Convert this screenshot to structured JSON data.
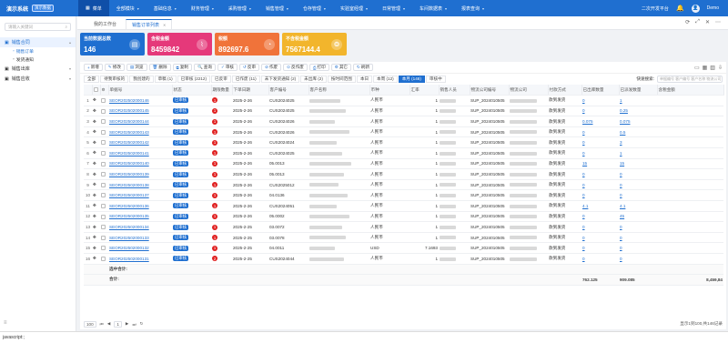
{
  "topbar": {
    "title": "演示系统",
    "env_tag": "演示数据",
    "nav": [
      {
        "label": "菜单",
        "icon": "grid-icon",
        "active": true
      },
      {
        "label": "全部模块",
        "active": false
      },
      {
        "label": "基础信息",
        "active": false
      },
      {
        "label": "财务管理",
        "active": false
      },
      {
        "label": "采购管理",
        "active": false
      },
      {
        "label": "销售管理",
        "active": false
      },
      {
        "label": "仓存管理",
        "active": false
      },
      {
        "label": "实验室经理",
        "active": false
      },
      {
        "label": "日常管理",
        "active": false
      },
      {
        "label": "车间数据表",
        "active": false
      },
      {
        "label": "报表查询",
        "active": false
      }
    ],
    "platform_label": "二次开发平台",
    "user_name": "Demo"
  },
  "sidebar": {
    "search_placeholder": "请输入关键词",
    "groups": [
      {
        "label": "销售合同",
        "open": true,
        "subs": [
          {
            "label": "销售订单",
            "active": true
          },
          {
            "label": "发货通知",
            "active": false
          }
        ]
      },
      {
        "label": "销售出库",
        "open": false,
        "subs": []
      },
      {
        "label": "销售应收",
        "open": false,
        "subs": []
      }
    ]
  },
  "page_tabs": [
    {
      "label": "我的工作台",
      "active": false
    },
    {
      "label": "销售订单列表",
      "active": true
    }
  ],
  "cards": [
    {
      "label": "当前数据总数",
      "value": "146",
      "color": "#1f6fd0",
      "icon": "document-icon"
    },
    {
      "label": "含税金额",
      "value": "8459842",
      "color": "#e5397a",
      "icon": "chart-icon"
    },
    {
      "label": "税额",
      "value": "892697.6",
      "color": "#f0733a",
      "icon": "pie-icon"
    },
    {
      "label": "不含税金额",
      "value": "7567144.4",
      "color": "#f2b52c",
      "icon": "coins-icon"
    }
  ],
  "toolbar": [
    {
      "label": "新增",
      "icon": "+"
    },
    {
      "label": "修改",
      "icon": "✎"
    },
    {
      "label": "浏览",
      "icon": "▤"
    },
    {
      "label": "删除",
      "icon": "🗑"
    },
    {
      "label": "复制",
      "icon": "⧉"
    },
    {
      "label": "查询",
      "icon": "🔍"
    },
    {
      "label": "审核",
      "icon": "✓"
    },
    {
      "label": "反审",
      "icon": "↺"
    },
    {
      "label": "作废",
      "icon": "⊘"
    },
    {
      "label": "反作废",
      "icon": "⊙"
    },
    {
      "label": "打印",
      "icon": "⎙"
    },
    {
      "label": "其它",
      "icon": "⚙"
    },
    {
      "label": "刷新",
      "icon": "↻"
    }
  ],
  "filters": [
    {
      "label": "全部",
      "active": false
    },
    {
      "label": "待我审核的",
      "active": false
    },
    {
      "label": "我创建的",
      "active": false
    },
    {
      "label": "草稿 (1)",
      "active": false
    },
    {
      "label": "已审核 (2212)",
      "active": false
    },
    {
      "label": "已反审",
      "active": false
    },
    {
      "label": "已作废 (11)",
      "active": false
    },
    {
      "label": "未下发货通知 (2)",
      "active": false
    },
    {
      "label": "未出库 (2)",
      "active": false
    },
    {
      "label": "按时间范围",
      "active": false
    },
    {
      "label": "本日",
      "active": false
    },
    {
      "label": "本周 (12)",
      "active": false
    },
    {
      "label": "本月 (146)",
      "active": true
    },
    {
      "label": "审核中",
      "active": false
    }
  ],
  "quick_search": {
    "label": "快速搜索:",
    "placeholder": "单据编号 客户编号 客户名称 物流公司"
  },
  "table": {
    "columns": [
      "",
      "",
      "",
      "单据号",
      "状态",
      "期限数量",
      "下单日期",
      "客户编号",
      "客户名称",
      "币种",
      "汇率",
      "销售人员",
      "物流公司编号",
      "物流公司",
      "付款方式",
      "已出库数量",
      "已派发数量",
      "含税金额"
    ],
    "rows": [
      {
        "n": "1",
        "no": "SEOR202502000146",
        "status": "已审核",
        "deadline": "1",
        "date": "2025-2-26",
        "cust": "CUS2024025",
        "cur": "人民币",
        "rate": "1",
        "log": "SUP_2024010505",
        "pay": "款到发货",
        "out": "0",
        "sent": "1",
        "amt": ""
      },
      {
        "n": "2",
        "no": "SEOR202502000145",
        "status": "已审核",
        "deadline": "1",
        "date": "2025-2-26",
        "cust": "CUS2024025",
        "cur": "人民币",
        "rate": "1",
        "log": "SUP_2024010505",
        "pay": "款到发货",
        "out": "0",
        "sent": "0.25",
        "amt": ""
      },
      {
        "n": "3",
        "no": "SEOR202502000144",
        "status": "已审核",
        "deadline": "1",
        "date": "2025-2-26",
        "cust": "CUS2024026",
        "cur": "人民币",
        "rate": "1",
        "log": "SUP_2024010505",
        "pay": "款到发货",
        "out": "0.075",
        "sent": "0.075",
        "amt": ""
      },
      {
        "n": "4",
        "no": "SEOR202502000143",
        "status": "已审核",
        "deadline": "1",
        "date": "2025-2-26",
        "cust": "CUS2024026",
        "cur": "人民币",
        "rate": "1",
        "log": "SUP_2024010505",
        "pay": "款到发货",
        "out": "0",
        "sent": "0.5",
        "amt": ""
      },
      {
        "n": "5",
        "no": "SEOR202502000142",
        "status": "已审核",
        "deadline": "1",
        "date": "2025-2-26",
        "cust": "CUS2024024",
        "cur": "人民币",
        "rate": "1",
        "log": "SUP_2024010505",
        "pay": "款到发货",
        "out": "0",
        "sent": "3",
        "amt": ""
      },
      {
        "n": "6",
        "no": "SEOR202502000141",
        "status": "已审核",
        "deadline": "1",
        "date": "2025-2-26",
        "cust": "CUS2024025",
        "cur": "人民币",
        "rate": "1",
        "log": "SUP_2024010505",
        "pay": "款到发货",
        "out": "0",
        "sent": "1",
        "amt": ""
      },
      {
        "n": "7",
        "no": "SEOR202502000140",
        "status": "已审核",
        "deadline": "1",
        "date": "2025-2-26",
        "cust": "05.0013",
        "cur": "人民币",
        "rate": "1",
        "log": "SUP_2024010505",
        "pay": "款到发货",
        "out": "15",
        "sent": "15",
        "amt": ""
      },
      {
        "n": "8",
        "no": "SEOR202502000139",
        "status": "已审核",
        "deadline": "1",
        "date": "2025-2-26",
        "cust": "05.0013",
        "cur": "人民币",
        "rate": "1",
        "log": "SUP_2024010505",
        "pay": "款到发货",
        "out": "0",
        "sent": "0",
        "amt": ""
      },
      {
        "n": "9",
        "no": "SEOR202502000138",
        "status": "已审核",
        "deadline": "1",
        "date": "2025-2-26",
        "cust": "CUS2025012",
        "cur": "人民币",
        "rate": "1",
        "log": "SUP_2024010505",
        "pay": "款到发货",
        "out": "0",
        "sent": "0",
        "amt": ""
      },
      {
        "n": "10",
        "no": "SEOR202502000137",
        "status": "已审核",
        "deadline": "1",
        "date": "2025-2-26",
        "cust": "04.0136",
        "cur": "人民币",
        "rate": "1",
        "log": "SUP_2024010505",
        "pay": "款到发货",
        "out": "0",
        "sent": "0",
        "amt": ""
      },
      {
        "n": "11",
        "no": "SEOR202502000136",
        "status": "已审核",
        "deadline": "1",
        "date": "2025-2-26",
        "cust": "CUS2024051",
        "cur": "人民币",
        "rate": "1",
        "log": "SUP_2024010505",
        "pay": "款到发货",
        "out": "4.1",
        "sent": "4.1",
        "amt": ""
      },
      {
        "n": "12",
        "no": "SEOR202502000135",
        "status": "已审核",
        "deadline": "1",
        "date": "2025-2-26",
        "cust": "05.0002",
        "cur": "人民币",
        "rate": "1",
        "log": "SUP_2024010505",
        "pay": "款到发货",
        "out": "0",
        "sent": "45",
        "amt": ""
      },
      {
        "n": "13",
        "no": "SEOR202502000134",
        "status": "已审核",
        "deadline": "1",
        "date": "2025-2-25",
        "cust": "03.0072",
        "cur": "人民币",
        "rate": "1",
        "log": "SUP_2024010505",
        "pay": "款到发货",
        "out": "0",
        "sent": "0",
        "amt": ""
      },
      {
        "n": "14",
        "no": "SEOR202502000133",
        "status": "已审核",
        "deadline": "1",
        "date": "2025-2-25",
        "cust": "03.0078",
        "cur": "人民币",
        "rate": "1",
        "log": "SUP_2024010505",
        "pay": "款到发货",
        "out": "0",
        "sent": "0",
        "amt": ""
      },
      {
        "n": "15",
        "no": "SEOR202502000132",
        "status": "已审核",
        "deadline": "1",
        "date": "2025-2-25",
        "cust": "04.0011",
        "cur": "USD",
        "rate": "7.1693",
        "log": "SUP_2024010505",
        "pay": "款到发货",
        "out": "0",
        "sent": "0",
        "amt": ""
      },
      {
        "n": "16",
        "no": "SEOR202502000131",
        "status": "已审核",
        "deadline": "2",
        "date": "2025-2-25",
        "cust": "CUS2024044",
        "cur": "人民币",
        "rate": "1",
        "log": "SUP_2024010505",
        "pay": "款到发货",
        "out": "0",
        "sent": "0",
        "amt": ""
      }
    ],
    "subtotal_label": "选中合计:",
    "total_label": "合计:",
    "total_out": "762.125",
    "total_sent": "909.085",
    "total_amt": "8,459,84"
  },
  "pager": {
    "page_size": "100",
    "page_info": "1",
    "summary": "显示1到100,共146记录"
  },
  "statusbar": "javascript:;"
}
